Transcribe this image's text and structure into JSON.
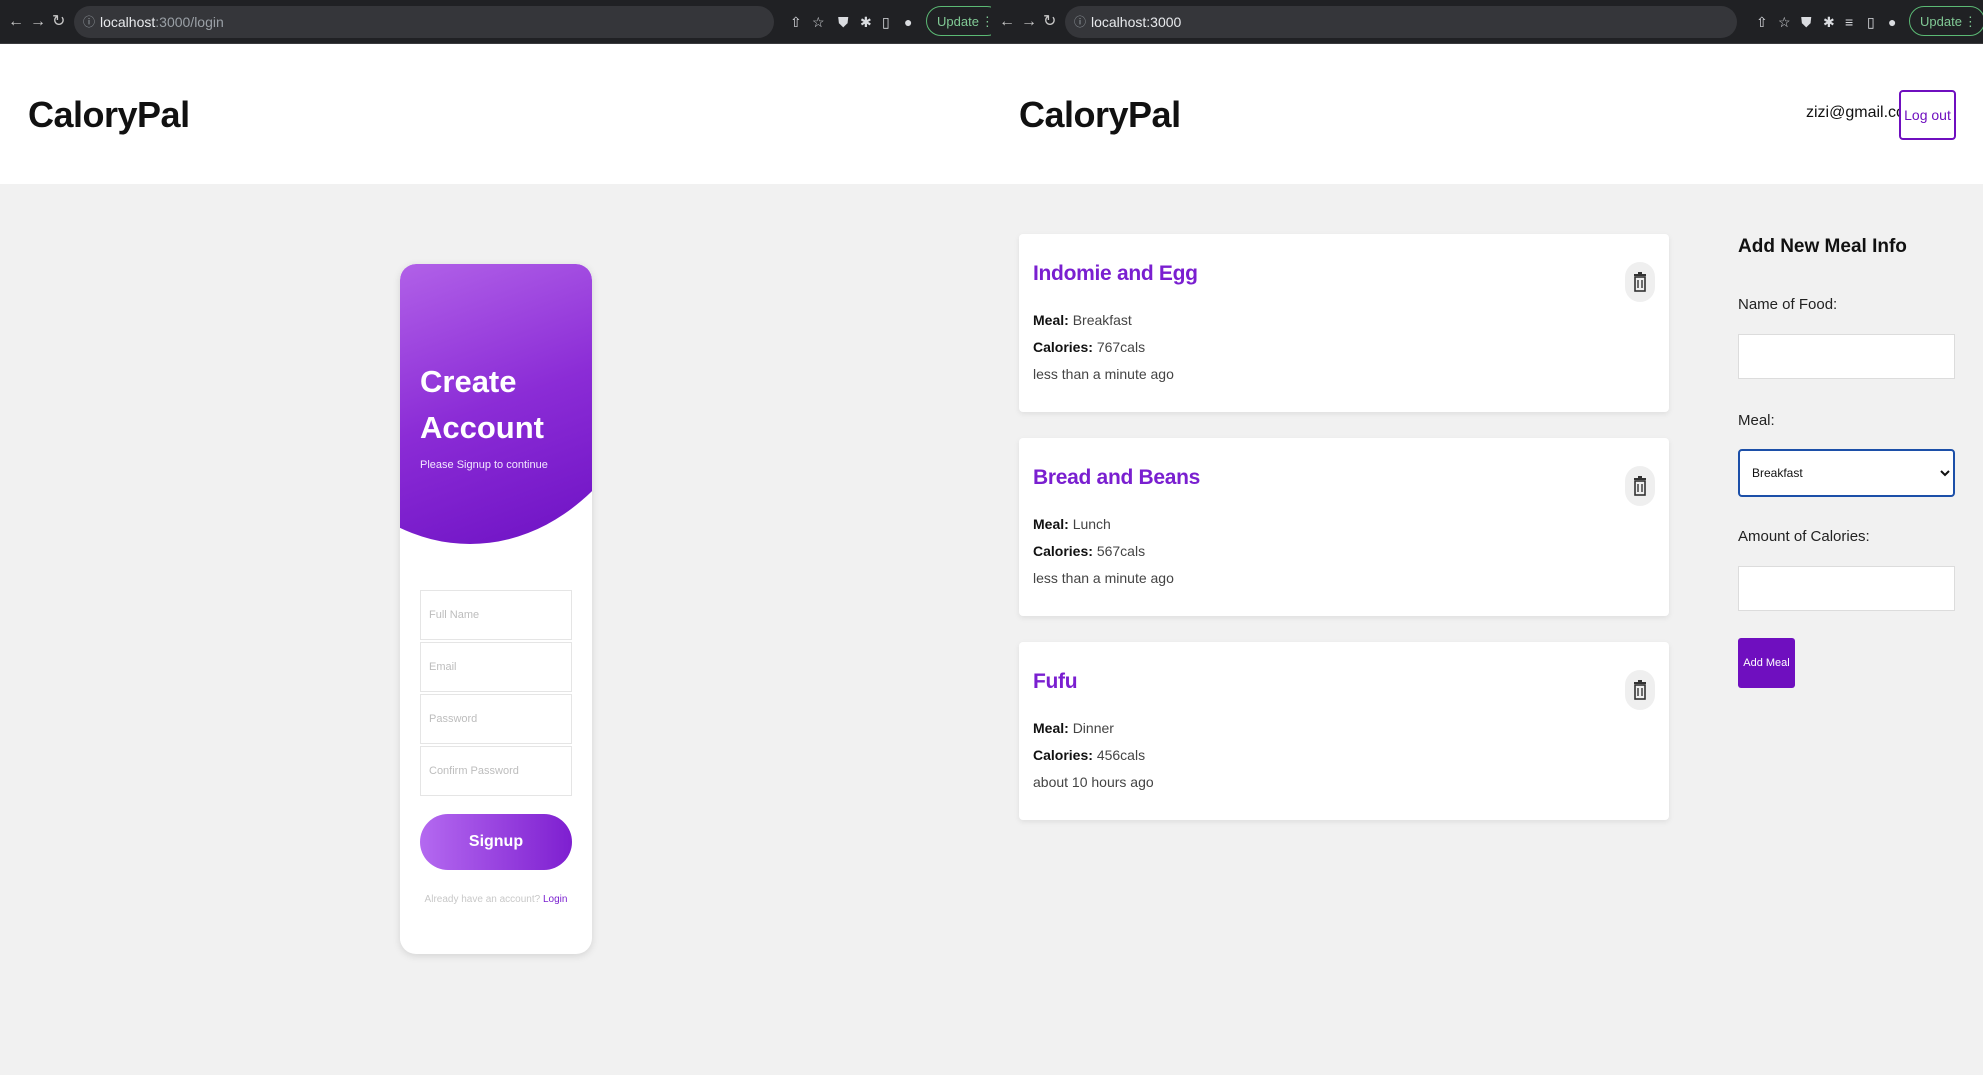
{
  "left_window": {
    "url_host": "localhost",
    "url_path": ":3000/login",
    "update_label": "Update",
    "brand": "CaloryPal",
    "signup": {
      "title_line1": "Create",
      "title_line2": "Account",
      "subtitle": "Please Signup to continue",
      "full_name_placeholder": "Full Name",
      "email_placeholder": "Email",
      "password_placeholder": "Password",
      "confirm_password_placeholder": "Confirm Password",
      "signup_label": "Signup",
      "footer_text": "Already have an account?",
      "login_link": "Login"
    }
  },
  "right_window": {
    "url_host": "localhost",
    "url_path": ":3000",
    "update_label": "Update",
    "brand": "CaloryPal",
    "user_email": "zizi@gmail.com",
    "logout_label": "Log out",
    "meal_label": "Meal:",
    "calories_label": "Calories:",
    "meals": [
      {
        "name": "Indomie and Egg",
        "meal": "Breakfast",
        "calories": "767cals",
        "time": "less than a minute ago"
      },
      {
        "name": "Bread and Beans",
        "meal": "Lunch",
        "calories": "567cals",
        "time": "less than a minute ago"
      },
      {
        "name": "Fufu",
        "meal": "Dinner",
        "calories": "456cals",
        "time": "about 10 hours ago"
      }
    ],
    "form": {
      "title": "Add New Meal Info",
      "food_label": "Name of Food:",
      "meal_label": "Meal:",
      "meal_selected": "Breakfast",
      "calories_label": "Amount of Calories:",
      "add_label": "Add Meal"
    }
  },
  "colors": {
    "accent": "#6f0fbf",
    "meal_title": "#7a1fd0",
    "chrome_bg": "#202124",
    "body_bg": "#f1f1f1"
  }
}
